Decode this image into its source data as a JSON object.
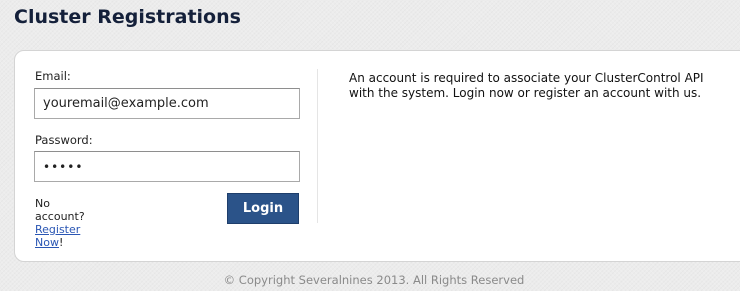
{
  "header": {
    "title": "Cluster Registrations"
  },
  "login_form": {
    "email_label": "Email:",
    "email_value": "youremail@example.com",
    "password_label": "Password:",
    "password_value": "•••••",
    "no_account_text": "No account?",
    "register_link": "Register Now",
    "register_suffix": "!",
    "login_button": "Login"
  },
  "info": {
    "text": "An account is required to associate your ClusterControl API with the system. Login now or register an account with us."
  },
  "footer": {
    "copyright": "© Copyright Severalnines 2013. All Rights Reserved"
  },
  "colors": {
    "background": "#ececec",
    "title": "#14203a",
    "login_button": "#2b5389",
    "link": "#2a56b4",
    "footer_text": "#8a8a8a"
  }
}
